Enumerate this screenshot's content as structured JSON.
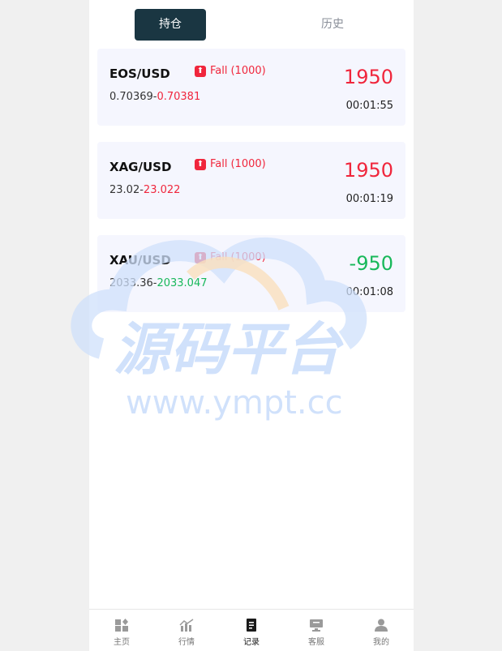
{
  "tabs": [
    {
      "label": "持仓",
      "active": true
    },
    {
      "label": "历史",
      "active": false
    }
  ],
  "positions": [
    {
      "symbol": "EOS/USD",
      "direction": "Fall",
      "amount": "(1000)",
      "open_price": "0.70369",
      "current_price": "0.70381",
      "profit": "1950",
      "timer": "00:01:55"
    },
    {
      "symbol": "XAG/USD",
      "direction": "Fall",
      "amount": "(1000)",
      "open_price": "23.02",
      "current_price": "23.022",
      "profit": "1950",
      "timer": "00:01:19"
    },
    {
      "symbol": "XAU/USD",
      "direction": "Fall",
      "amount": "(1000)",
      "open_price": "2033.36",
      "current_price": "2033.047",
      "profit": "-950",
      "timer": "00:01:08"
    }
  ],
  "watermark": {
    "title": "源码平台",
    "url": "www.ympt.cc"
  },
  "nav": [
    {
      "label": "主页",
      "icon": "home-icon"
    },
    {
      "label": "行情",
      "icon": "chart-icon"
    },
    {
      "label": "记录",
      "icon": "record-icon",
      "active": true
    },
    {
      "label": "客服",
      "icon": "service-icon"
    },
    {
      "label": "我的",
      "icon": "user-icon"
    }
  ],
  "colors": {
    "loss": "#f0263c",
    "gain": "#18b85a",
    "tab_active_bg": "#1a3642",
    "card_bg": "#f5f6fe"
  }
}
